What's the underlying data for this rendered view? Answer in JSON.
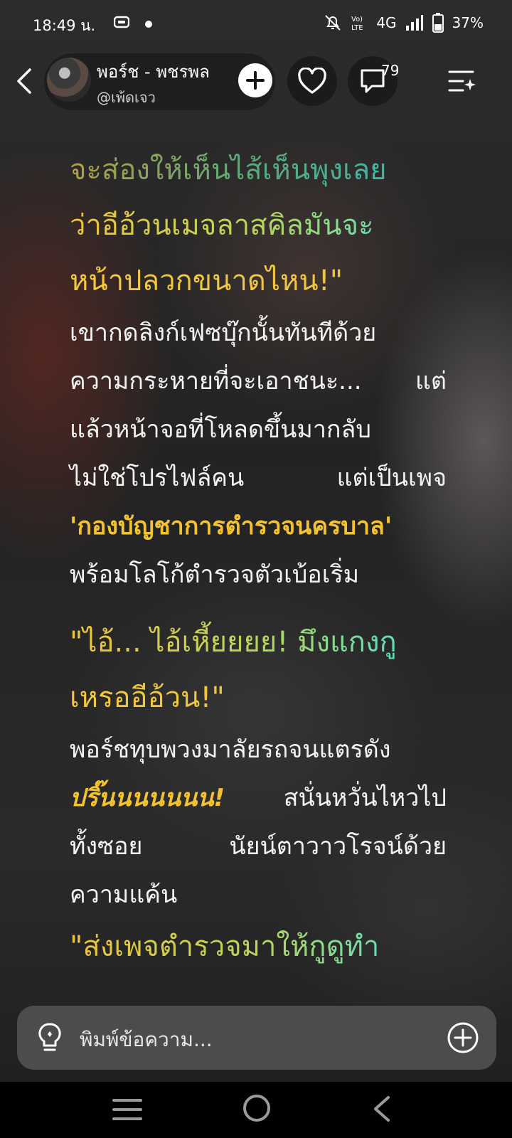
{
  "status_bar": {
    "time": "18:49 น.",
    "network": "4G",
    "battery": "37%",
    "icons": [
      "sim-card-icon",
      "dot-icon",
      "mute-bell-icon",
      "volte-icon",
      "signal-icon",
      "battery-icon"
    ]
  },
  "header": {
    "author_name": "พอร์ช - พชรพล",
    "author_handle": "@เพ้ดเจว",
    "comment_count": "79",
    "icons": [
      "back-arrow-icon",
      "plus-icon",
      "heart-icon",
      "comment-bubble-icon",
      "menu-sparkle-icon"
    ]
  },
  "story": {
    "dialog1": [
      "จะส่องให้เห็นไส้เห็นพุงเลย",
      "ว่าอีอ้วนเมจลาสคิลมันจะ",
      "หน้าปลวกขนาดไหน!\""
    ],
    "para1": {
      "line1": "เขากดลิงก์เฟซบุ๊กนั้นทันทีด้วย",
      "line2a": "ความกระหายที่จะเอาชนะ...",
      "line2b": "แต่",
      "line3": "แล้วหน้าจอที่โหลดขึ้นมากลับ",
      "line4a": "ไม่ใช่โปรไฟล์คน",
      "line4b": "แต่เป็นเพจ",
      "line5": "'กองบัญชาการตำรวจนครบาล'",
      "line6": "พร้อมโลโก้ตำรวจตัวเบ้อเริ่ม"
    },
    "dialog2": [
      "\"ไอ้... ไอ้เหี้ยยยย! มึงแกงกู",
      "เหรออีอ้วน!\""
    ],
    "para2": {
      "line1": "พอร์ชทุบพวงมาลัยรถจนแตรดัง",
      "line2a": "ปริ๊นนนนนนน!",
      "line2b": "สนั่นหวั่นไหวไป",
      "line3a": "ทั้งซอย",
      "line3b": "นัยน์ตาวาวโรจน์ด้วย",
      "line4": "ความแค้น"
    },
    "dialog3": "\"ส่งเพจตำรวจมาให้กูดูทำ",
    "colors": {
      "highlight": "#f4c430",
      "dialog_start": "#f0c43a",
      "dialog_end": "#3fe0e0"
    }
  },
  "input": {
    "placeholder": "พิมพ์ข้อความ...",
    "icons": [
      "lightbulb-icon",
      "add-circle-icon"
    ]
  },
  "nav_bar": {
    "icons": [
      "recents-icon",
      "home-icon",
      "back-icon"
    ]
  }
}
